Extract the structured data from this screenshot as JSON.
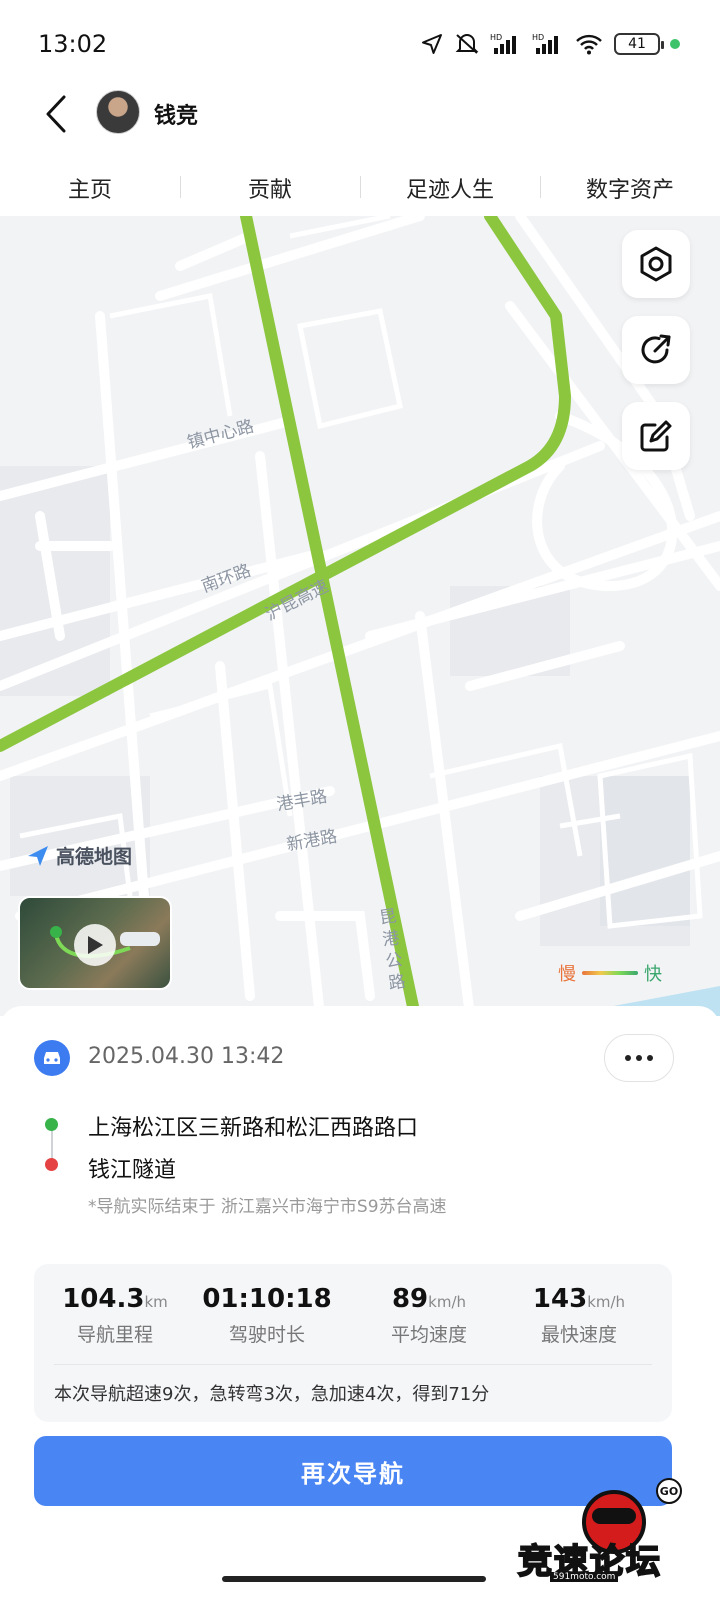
{
  "status_bar": {
    "time": "13:02",
    "battery": "41",
    "icons": [
      "location-arrow-icon",
      "mute-icon",
      "hd-signal-icon",
      "hd-signal-icon",
      "wifi-icon",
      "battery-icon",
      "charging-dot-icon"
    ]
  },
  "header": {
    "user_name": "钱竞",
    "back_icon": "chevron-left-icon"
  },
  "tabs": [
    "主页",
    "贡献",
    "足迹人生",
    "数字资产"
  ],
  "map": {
    "road_labels": {
      "zhenzhongxin": "镇中心路",
      "nanhuan": "南环路",
      "hukun": "沪昆高速",
      "gangfeng": "港丰路",
      "xingang": "新港路",
      "kungang": "昆港公路"
    },
    "provider": "高德地图",
    "tools": [
      "settings-hex-icon",
      "share-arrow-icon",
      "edit-pen-icon"
    ],
    "legend": {
      "slow": "慢",
      "fast": "快"
    },
    "route_color": "#8cc63f"
  },
  "trip": {
    "datetime": "2025.04.30 13:42",
    "from": "上海松江区三新路和松汇西路路口",
    "to": "钱江隧道",
    "note": "*导航实际结束于 浙江嘉兴市海宁市S9苏台高速",
    "stats": [
      {
        "value": "104.3",
        "unit": "km",
        "label": "导航里程"
      },
      {
        "value": "01:10:18",
        "unit": "",
        "label": "驾驶时长"
      },
      {
        "value": "89",
        "unit": "km/h",
        "label": "平均速度"
      },
      {
        "value": "143",
        "unit": "km/h",
        "label": "最快速度"
      }
    ],
    "summary": "本次导航超速9次，急转弯3次，急加速4次，得到71分",
    "navigate_again": "再次导航"
  },
  "watermark": {
    "text": "竞速论坛",
    "go": "GO",
    "url": "591moto.com"
  },
  "colors": {
    "accent": "#4a86f3",
    "start": "#37b34a",
    "end": "#e54343"
  }
}
